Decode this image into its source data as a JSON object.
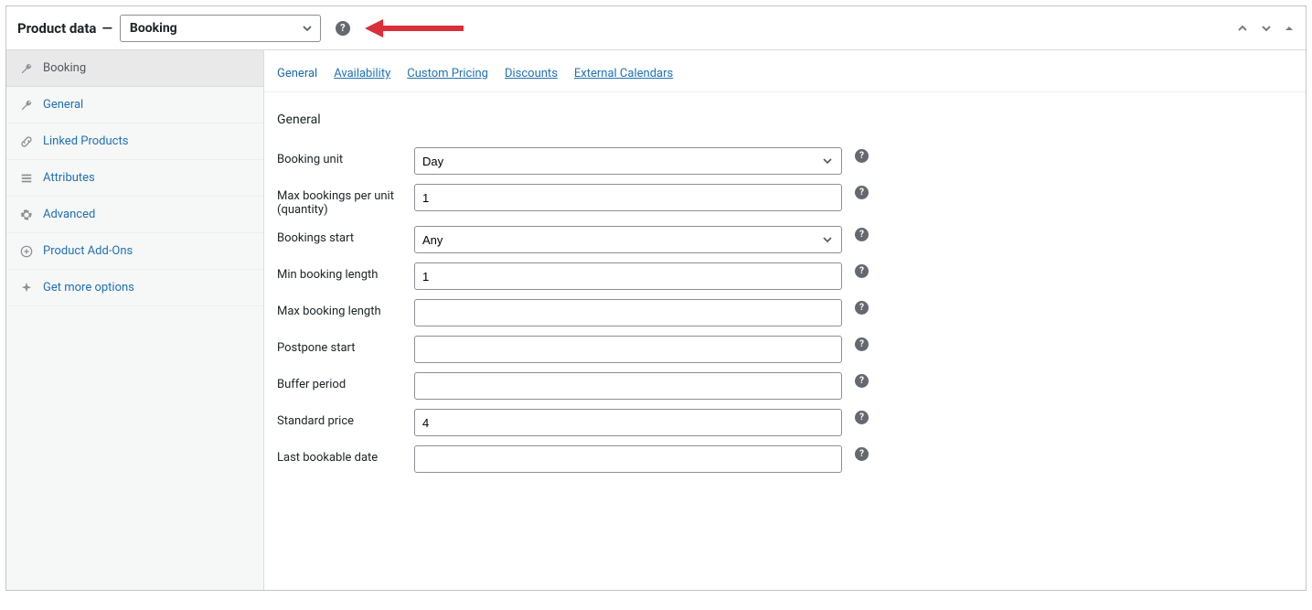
{
  "header": {
    "title": "Product data",
    "dash": "—",
    "dropdown_value": "Booking"
  },
  "sidebar": {
    "items": [
      {
        "label": "Booking"
      },
      {
        "label": "General"
      },
      {
        "label": "Linked Products"
      },
      {
        "label": "Attributes"
      },
      {
        "label": "Advanced"
      },
      {
        "label": "Product Add-Ons"
      },
      {
        "label": "Get more options"
      }
    ]
  },
  "tabs": {
    "items": [
      {
        "label": "General"
      },
      {
        "label": "Availability"
      },
      {
        "label": "Custom Pricing"
      },
      {
        "label": "Discounts"
      },
      {
        "label": "External Calendars"
      }
    ]
  },
  "section": {
    "title": "General"
  },
  "fields": {
    "booking_unit_label": "Booking unit",
    "booking_unit_value": "Day",
    "max_bookings_label": "Max bookings per unit (quantity)",
    "max_bookings_value": "1",
    "bookings_start_label": "Bookings start",
    "bookings_start_value": "Any",
    "min_len_label": "Min booking length",
    "min_len_value": "1",
    "max_len_label": "Max booking length",
    "max_len_value": "",
    "postpone_label": "Postpone start",
    "postpone_value": "",
    "buffer_label": "Buffer period",
    "buffer_value": "",
    "price_label": "Standard price",
    "price_value": "4",
    "last_label": "Last bookable date",
    "last_value": ""
  }
}
